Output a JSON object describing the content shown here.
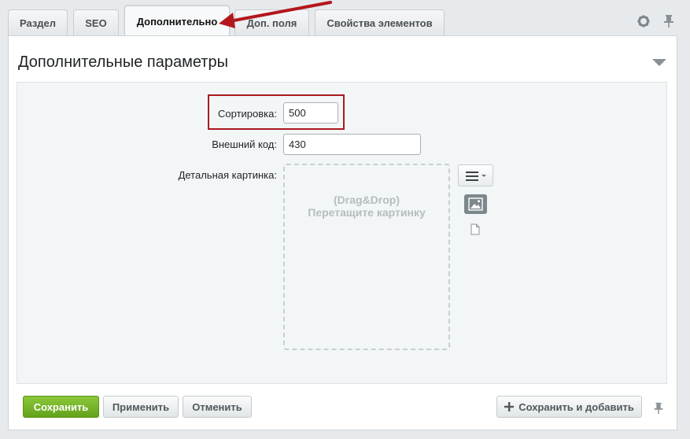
{
  "tabs": [
    {
      "label": "Раздел"
    },
    {
      "label": "SEO"
    },
    {
      "label": "Дополнительно"
    },
    {
      "label": "Доп. поля"
    },
    {
      "label": "Свойства элементов"
    }
  ],
  "active_tab": "Дополнительно",
  "section": {
    "title": "Дополнительные параметры"
  },
  "form": {
    "sort_label": "Сортировка:",
    "sort_value": "500",
    "external_code_label": "Внешний код:",
    "external_code_value": "430",
    "picture_label": "Детальная картинка:",
    "dropzone_line1": "(Drag&Drop)",
    "dropzone_line2": "Перетащите картинку"
  },
  "buttons": {
    "save": "Сохранить",
    "apply": "Применить",
    "cancel": "Отменить",
    "save_add": "Сохранить и добавить"
  },
  "icons": [
    "gear-icon",
    "pin-icon",
    "menu-icon",
    "image-icon",
    "file-icon",
    "plus-icon",
    "arrow-annotation"
  ],
  "colors": {
    "accent_green": "#6fb02a",
    "highlight_red": "#a91a1e",
    "annotation_red": "#b3171d"
  }
}
